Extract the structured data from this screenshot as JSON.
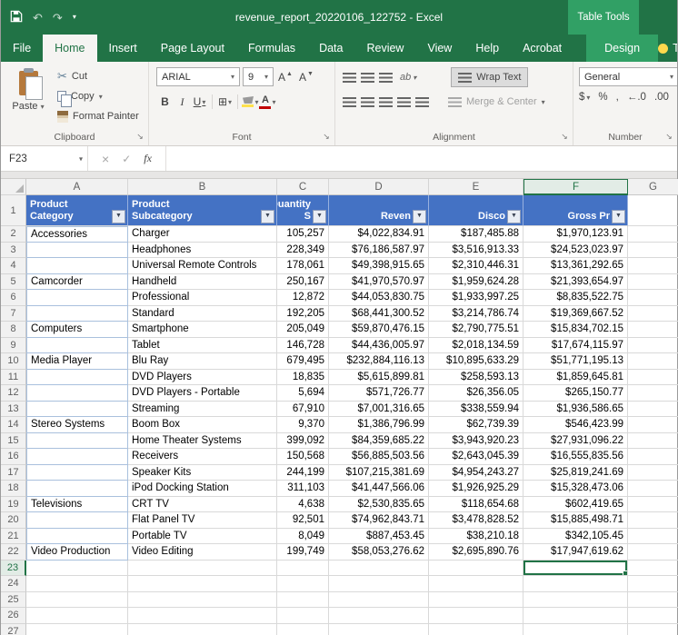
{
  "titlebar": {
    "title": "revenue_report_20220106_122752  -  Excel",
    "context_group": "Table Tools"
  },
  "tabs": {
    "items": [
      "File",
      "Home",
      "Insert",
      "Page Layout",
      "Formulas",
      "Data",
      "Review",
      "View",
      "Help",
      "Acrobat"
    ],
    "active": "Home",
    "contextual": "Design",
    "tell_me": "T"
  },
  "ribbon": {
    "clipboard": {
      "group": "Clipboard",
      "paste": "Paste",
      "cut": "Cut",
      "copy": "Copy",
      "format_painter": "Format Painter"
    },
    "font": {
      "group": "Font",
      "name": "ARIAL",
      "size": "9",
      "bold": "B",
      "italic": "I",
      "underline": "U"
    },
    "alignment": {
      "group": "Alignment",
      "orientation": "ab",
      "wrap": "Wrap Text",
      "merge": "Merge & Center"
    },
    "number": {
      "group": "Number",
      "format": "General",
      "currency": "$",
      "percent": "%",
      "comma": ",",
      "inc_decimal": "←.0",
      "dec_decimal": ".00"
    }
  },
  "formula_bar": {
    "name_box": "F23",
    "fx_label": "x",
    "fx_f": "f",
    "cancel": "×",
    "enter": "✓"
  },
  "sheet": {
    "active_cell": "F23",
    "active_column": "F",
    "active_row": 23,
    "visible_columns": [
      "A",
      "B",
      "C",
      "D",
      "E",
      "F",
      "G"
    ],
    "header_row": {
      "row": 1,
      "cells": [
        "Product\nCategory",
        "Product\nSubcategory",
        "Quantity\nS",
        "Reven",
        "Disco",
        "Gross Pr"
      ]
    },
    "rows": [
      {
        "n": 2,
        "cells": [
          "Accessories",
          "Charger",
          "105,257",
          "$4,022,834.91",
          "$187,485.88",
          "$1,970,123.91"
        ]
      },
      {
        "n": 3,
        "cells": [
          "",
          "Headphones",
          "228,349",
          "$76,186,587.97",
          "$3,516,913.33",
          "$24,523,023.97"
        ]
      },
      {
        "n": 4,
        "cells": [
          "",
          "Universal Remote Controls",
          "178,061",
          "$49,398,915.65",
          "$2,310,446.31",
          "$13,361,292.65"
        ]
      },
      {
        "n": 5,
        "cells": [
          "Camcorder",
          "Handheld",
          "250,167",
          "$41,970,570.97",
          "$1,959,624.28",
          "$21,393,654.97"
        ]
      },
      {
        "n": 6,
        "cells": [
          "",
          "Professional",
          "12,872",
          "$44,053,830.75",
          "$1,933,997.25",
          "$8,835,522.75"
        ]
      },
      {
        "n": 7,
        "cells": [
          "",
          "Standard",
          "192,205",
          "$68,441,300.52",
          "$3,214,786.74",
          "$19,369,667.52"
        ]
      },
      {
        "n": 8,
        "cells": [
          "Computers",
          "Smartphone",
          "205,049",
          "$59,870,476.15",
          "$2,790,775.51",
          "$15,834,702.15"
        ]
      },
      {
        "n": 9,
        "cells": [
          "",
          "Tablet",
          "146,728",
          "$44,436,005.97",
          "$2,018,134.59",
          "$17,674,115.97"
        ]
      },
      {
        "n": 10,
        "cells": [
          "Media Player",
          "Blu Ray",
          "679,495",
          "$232,884,116.13",
          "$10,895,633.29",
          "$51,771,195.13"
        ]
      },
      {
        "n": 11,
        "cells": [
          "",
          "DVD Players",
          "18,835",
          "$5,615,899.81",
          "$258,593.13",
          "$1,859,645.81"
        ]
      },
      {
        "n": 12,
        "cells": [
          "",
          "DVD Players - Portable",
          "5,694",
          "$571,726.77",
          "$26,356.05",
          "$265,150.77"
        ]
      },
      {
        "n": 13,
        "cells": [
          "",
          "Streaming",
          "67,910",
          "$7,001,316.65",
          "$338,559.94",
          "$1,936,586.65"
        ]
      },
      {
        "n": 14,
        "cells": [
          "Stereo Systems",
          "Boom Box",
          "9,370",
          "$1,386,796.99",
          "$62,739.39",
          "$546,423.99"
        ]
      },
      {
        "n": 15,
        "cells": [
          "",
          "Home Theater Systems",
          "399,092",
          "$84,359,685.22",
          "$3,943,920.23",
          "$27,931,096.22"
        ]
      },
      {
        "n": 16,
        "cells": [
          "",
          "Receivers",
          "150,568",
          "$56,885,503.56",
          "$2,643,045.39",
          "$16,555,835.56"
        ]
      },
      {
        "n": 17,
        "cells": [
          "",
          "Speaker Kits",
          "244,199",
          "$107,215,381.69",
          "$4,954,243.27",
          "$25,819,241.69"
        ]
      },
      {
        "n": 18,
        "cells": [
          "",
          "iPod Docking Station",
          "311,103",
          "$41,447,566.06",
          "$1,926,925.29",
          "$15,328,473.06"
        ]
      },
      {
        "n": 19,
        "cells": [
          "Televisions",
          "CRT TV",
          "4,638",
          "$2,530,835.65",
          "$118,654.68",
          "$602,419.65"
        ]
      },
      {
        "n": 20,
        "cells": [
          "",
          "Flat Panel TV",
          "92,501",
          "$74,962,843.71",
          "$3,478,828.52",
          "$15,885,498.71"
        ]
      },
      {
        "n": 21,
        "cells": [
          "",
          "Portable TV",
          "8,049",
          "$887,453.45",
          "$38,210.18",
          "$342,105.45"
        ]
      },
      {
        "n": 22,
        "cells": [
          "Video Production",
          "Video Editing",
          "199,749",
          "$58,053,276.62",
          "$2,695,890.76",
          "$17,947,619.62"
        ]
      }
    ],
    "empty_rows": [
      23,
      24,
      25,
      26,
      27
    ]
  },
  "colors": {
    "excel_green": "#217346",
    "contextual_green": "#31a065",
    "table_header_blue": "#4472C4"
  }
}
